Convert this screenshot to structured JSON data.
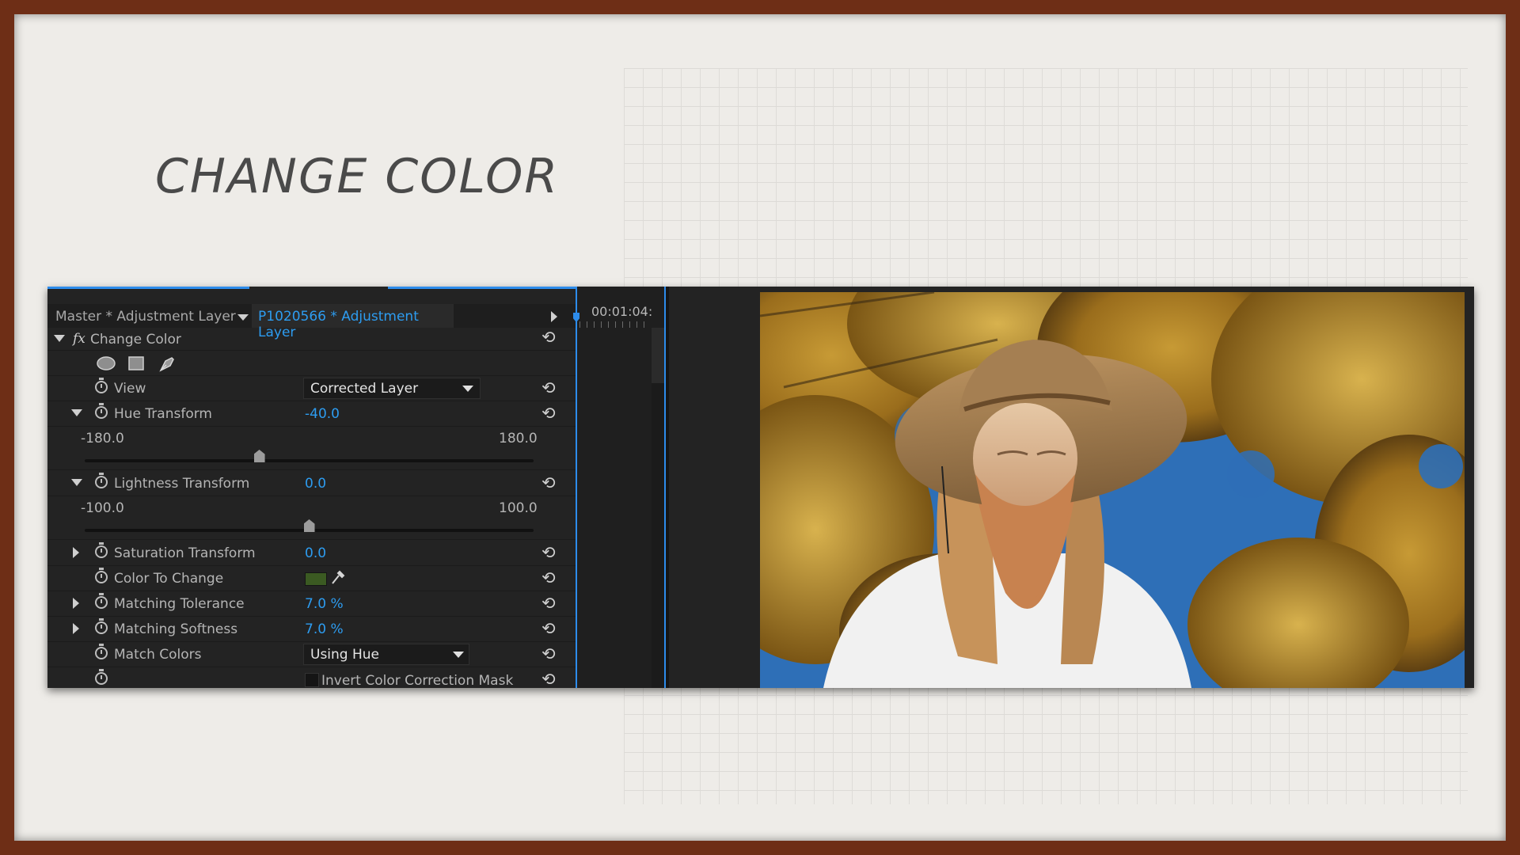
{
  "slide": {
    "title": "CHANGE COLOR"
  },
  "effect_controls": {
    "master_label": "Master * Adjustment Layer",
    "clip_label": "P1020566 * Adjustment Layer",
    "effect_name": "Change Color",
    "fx_label": "fx",
    "timecode": "00:01:04:",
    "properties": {
      "view": {
        "label": "View",
        "value": "Corrected Layer"
      },
      "hue_transform": {
        "label": "Hue Transform",
        "value": "-40.0",
        "min": "-180.0",
        "max": "180.0",
        "slider_fraction": 0.389
      },
      "lightness_transform": {
        "label": "Lightness Transform",
        "value": "0.0",
        "min": "-100.0",
        "max": "100.0",
        "slider_fraction": 0.5
      },
      "saturation_transform": {
        "label": "Saturation Transform",
        "value": "0.0"
      },
      "color_to_change": {
        "label": "Color To Change",
        "swatch_color": "#3b5a22"
      },
      "matching_tolerance": {
        "label": "Matching Tolerance",
        "value": "7.0 %"
      },
      "matching_softness": {
        "label": "Matching Softness",
        "value": "7.0 %"
      },
      "match_colors": {
        "label": "Match Colors",
        "value": "Using Hue"
      },
      "invert_mask": {
        "label": "Invert Color Correction Mask"
      }
    },
    "icons": {
      "mask_ellipse": "ellipse-mask-icon",
      "mask_rect": "rectangle-mask-icon",
      "mask_pen": "pen-mask-icon",
      "reset": "reset-icon",
      "stopwatch": "stopwatch-icon",
      "eyedropper": "eyedropper-icon"
    }
  },
  "colors": {
    "accent": "#2d9cf0",
    "panel_bg": "#232323",
    "slide_border": "#6e2e16"
  }
}
